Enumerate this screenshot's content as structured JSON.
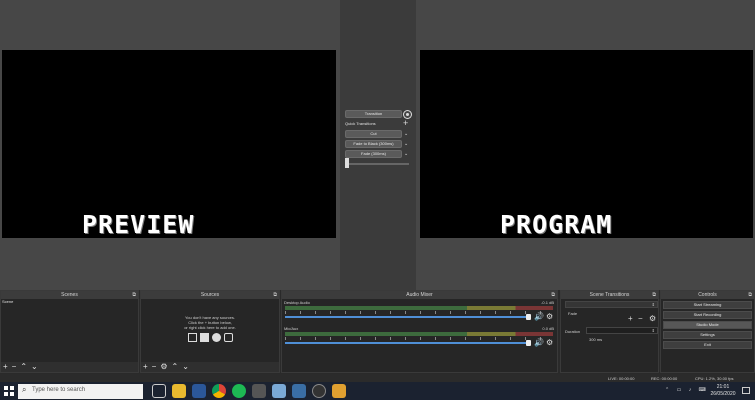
{
  "preview": {
    "label": "PREVIEW"
  },
  "program": {
    "label": "PROGRAM"
  },
  "transition_panel": {
    "transition_button": "Transition",
    "quick_transitions_label": "Quick Transitions",
    "quick_items": [
      "Cut",
      "Fade to Black (300ms)",
      "Fade (300ms)"
    ]
  },
  "docks": {
    "scenes": {
      "title": "Scenes",
      "items": [
        "Scene"
      ]
    },
    "sources": {
      "title": "Sources",
      "empty_lines": [
        "You don't have any sources.",
        "Click the + button below,",
        "or right click here to add one."
      ]
    },
    "audio_mixer": {
      "title": "Audio Mixer",
      "channels": [
        {
          "name": "Desktop Audio",
          "db": "-0.1 dB"
        },
        {
          "name": "Mic/Aux",
          "db": "0.0 dB"
        }
      ]
    },
    "scene_transitions": {
      "title": "Scene Transitions",
      "selected": "Fade",
      "duration_label": "Duration",
      "duration_value": "300 ms"
    },
    "controls": {
      "title": "Controls",
      "buttons": [
        "Start Streaming",
        "Start Recording",
        "Studio Mode",
        "Settings",
        "Exit"
      ],
      "active_index": 2
    }
  },
  "statusbar": {
    "live": "LIVE: 00:00:00",
    "rec": "REC: 00:00:00",
    "cpu": "CPU: 1.2%, 30.00 fps"
  },
  "taskbar": {
    "search_placeholder": "Type here to search",
    "time": "21:01",
    "date": "26/05/2020"
  }
}
